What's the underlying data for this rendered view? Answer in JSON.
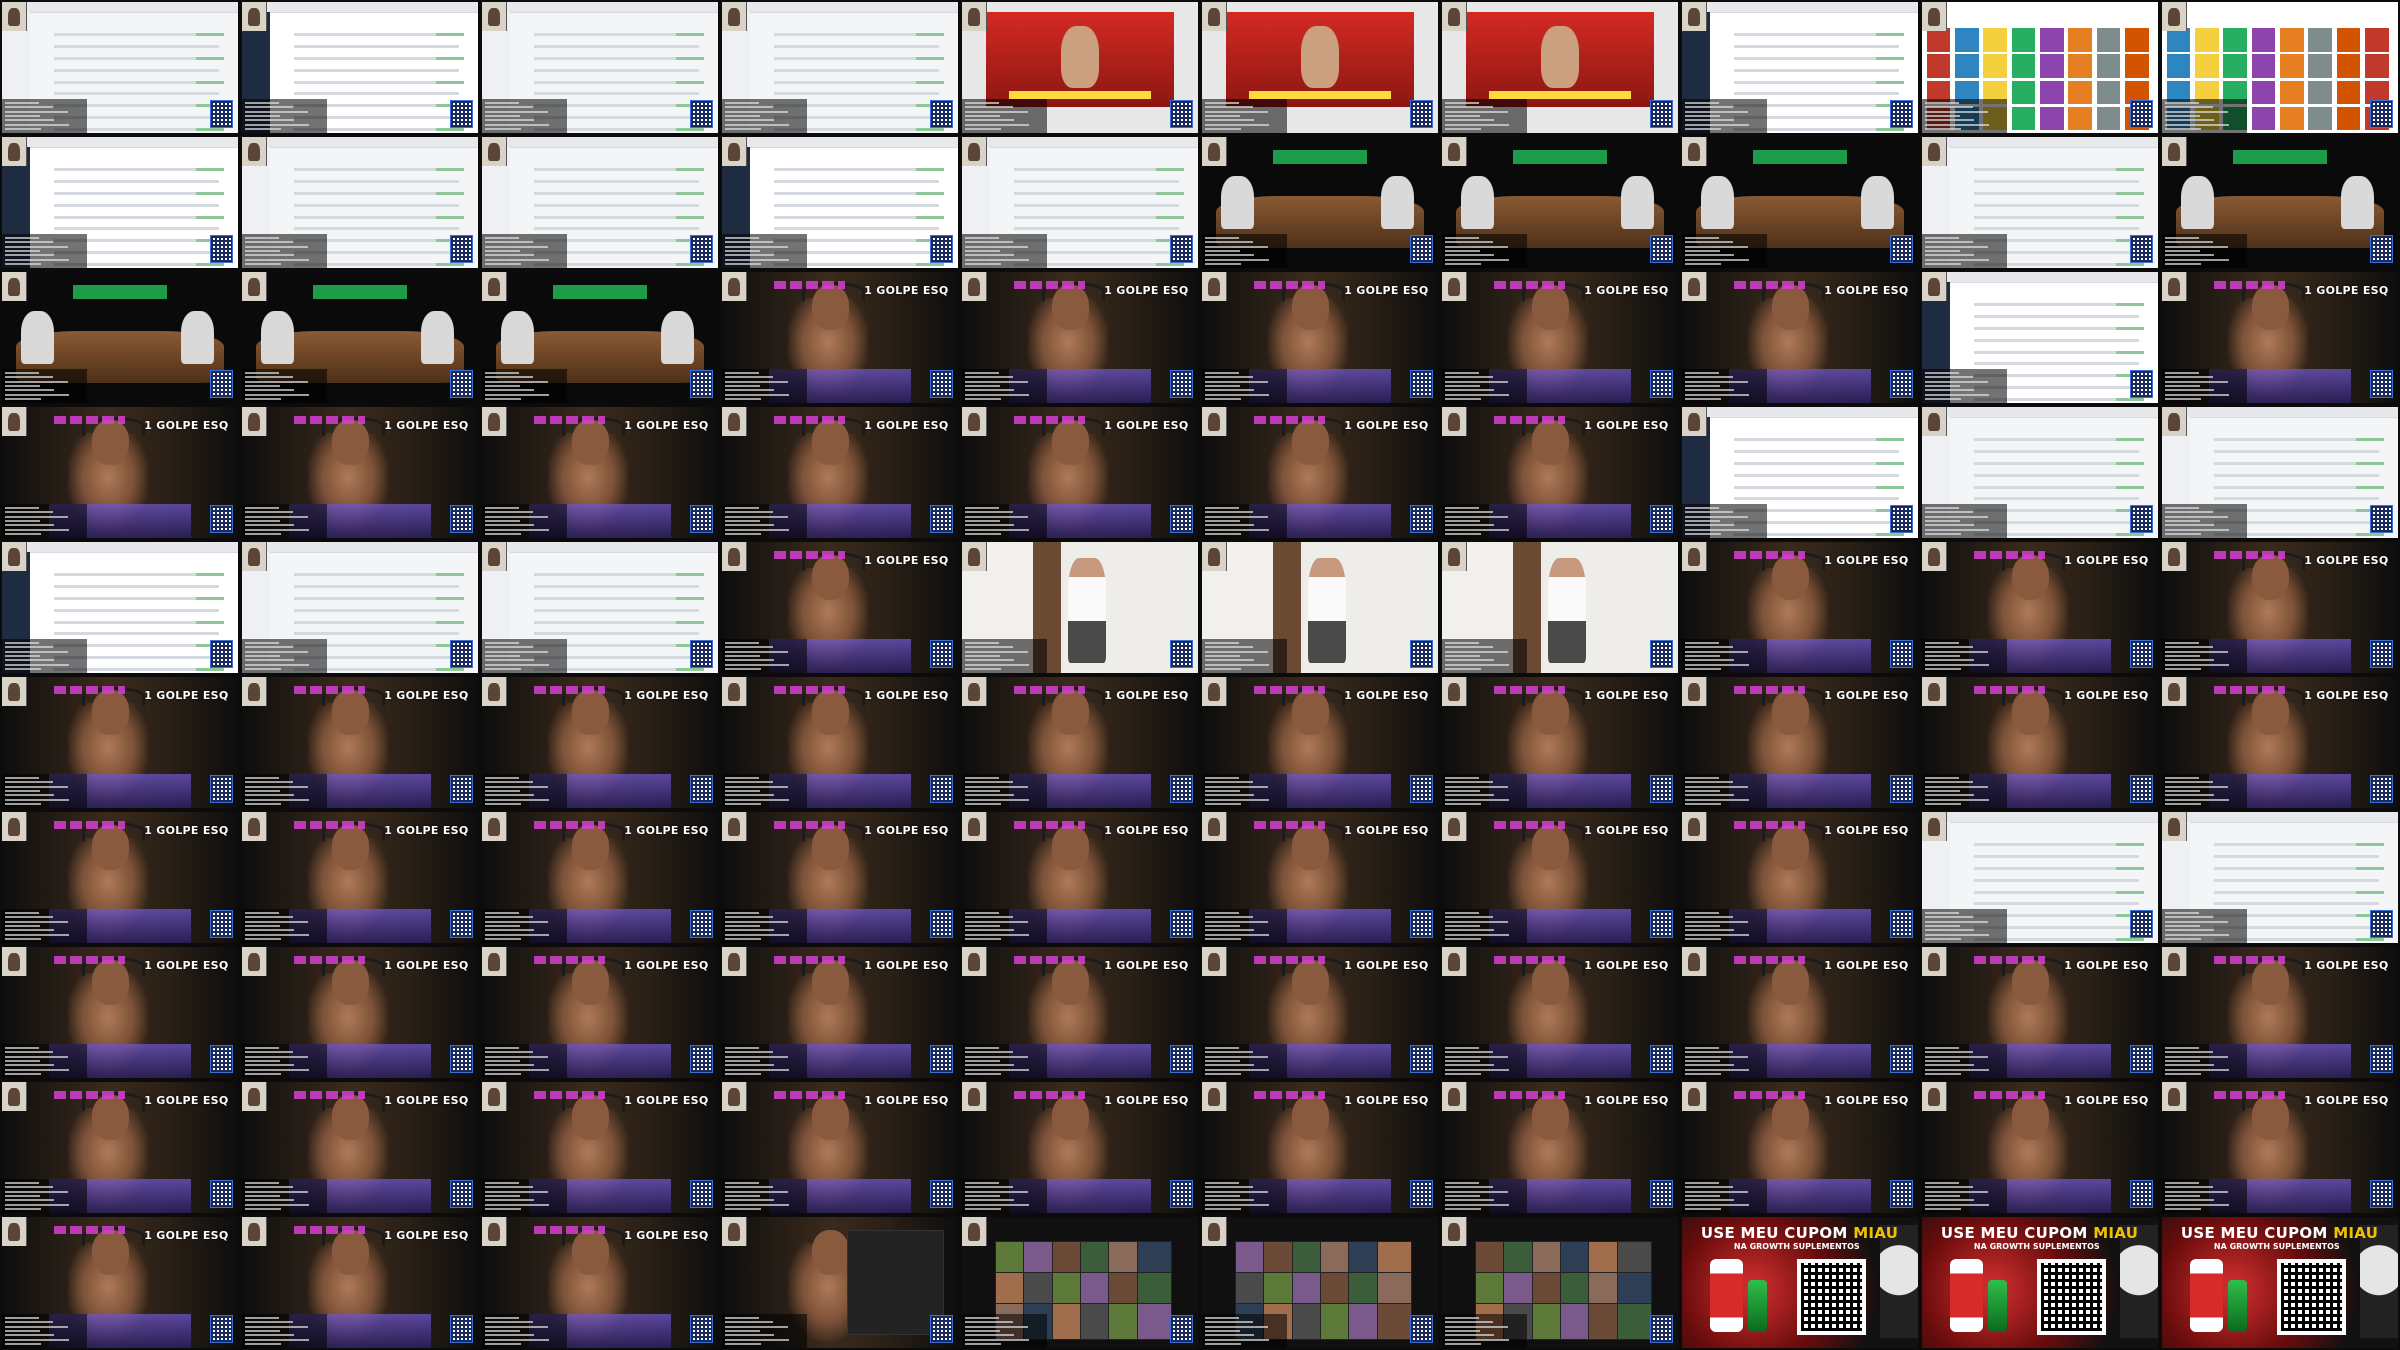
{
  "grid": {
    "cols": 10,
    "rows": 10
  },
  "overlay_texts": {
    "golpe": "1 GOLPE ESQ",
    "ad_headline_prefix": "USE MEU CUPOM ",
    "ad_headline_code": "MIAU",
    "ad_sub": "NA GROWTH SUPLEMENTOS"
  },
  "tiles": [
    "web",
    "web",
    "web",
    "web",
    "red",
    "red",
    "red",
    "web",
    "shop",
    "shop",
    "web",
    "web",
    "web",
    "web",
    "web",
    "table",
    "table",
    "table",
    "web",
    "table",
    "table",
    "table",
    "table",
    "stream",
    "stream",
    "stream",
    "stream",
    "stream",
    "web",
    "stream",
    "stream",
    "stream",
    "stream",
    "stream",
    "stream",
    "stream",
    "stream",
    "web",
    "web",
    "web",
    "web",
    "web",
    "web",
    "stream",
    "gym",
    "gym",
    "gym",
    "stream",
    "stream",
    "stream",
    "stream",
    "stream",
    "stream",
    "stream",
    "stream",
    "stream",
    "stream",
    "stream",
    "stream",
    "stream",
    "stream",
    "stream",
    "stream",
    "stream",
    "stream",
    "stream",
    "stream",
    "stream",
    "web",
    "web",
    "stream",
    "stream",
    "stream",
    "stream",
    "stream",
    "stream",
    "stream",
    "stream",
    "stream",
    "stream",
    "stream",
    "stream",
    "stream",
    "stream",
    "stream",
    "stream",
    "stream",
    "stream",
    "stream",
    "stream",
    "stream",
    "stream",
    "stream",
    "chat",
    "mosaic",
    "mosaic",
    "mosaic",
    "ad",
    "ad",
    "ad"
  ]
}
